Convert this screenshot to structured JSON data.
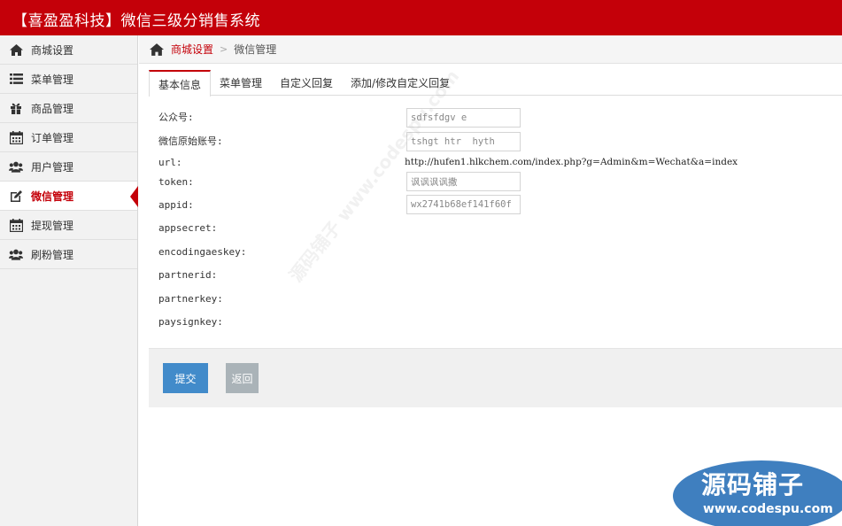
{
  "header": {
    "title": "【喜盈盈科技】微信三级分销售系统"
  },
  "sidebar": {
    "items": [
      {
        "label": "商城设置",
        "icon": "home-icon"
      },
      {
        "label": "菜单管理",
        "icon": "list-icon"
      },
      {
        "label": "商品管理",
        "icon": "gift-icon"
      },
      {
        "label": "订单管理",
        "icon": "calendar-icon"
      },
      {
        "label": "用户管理",
        "icon": "users-icon"
      },
      {
        "label": "微信管理",
        "icon": "edit-icon",
        "active": true
      },
      {
        "label": "提现管理",
        "icon": "calendar-icon"
      },
      {
        "label": "刷粉管理",
        "icon": "users-icon"
      }
    ]
  },
  "breadcrumb": {
    "parent": "商城设置",
    "separator": ">",
    "current": "微信管理"
  },
  "tabs": [
    {
      "label": "基本信息",
      "active": true
    },
    {
      "label": "菜单管理"
    },
    {
      "label": "自定义回复"
    },
    {
      "label": "添加/修改自定义回复"
    }
  ],
  "form": {
    "public_account": {
      "label": "公众号:",
      "value": "sdfsfdgv e"
    },
    "original_id": {
      "label": "微信原始账号:",
      "value": "tshgt htr  hyth"
    },
    "url": {
      "label": "url:",
      "value": "http://hufen1.hlkchem.com/index.php?g=Admin&m=Wechat&a=index"
    },
    "token": {
      "label": "token:",
      "value": "讽讽讽讽撒"
    },
    "appid": {
      "label": "appid:",
      "value": "wx2741b68ef141f60f"
    },
    "appsecret": {
      "label": "appsecret:"
    },
    "encodingaeskey": {
      "label": "encodingaeskey:"
    },
    "partnerid": {
      "label": "partnerid:"
    },
    "partnerkey": {
      "label": "partnerkey:"
    },
    "paysignkey": {
      "label": "paysignkey:"
    }
  },
  "actions": {
    "submit": "提交",
    "back": "返回"
  },
  "watermark": {
    "diagonal": "源码铺子 www.codespu.com",
    "badge_main": "源码铺子",
    "badge_url": "www.codespu.com"
  },
  "colors": {
    "brand_red": "#c40009",
    "primary_button": "#428bca",
    "secondary_button": "#aab3b8",
    "badge_blue": "#3f7fbf"
  }
}
